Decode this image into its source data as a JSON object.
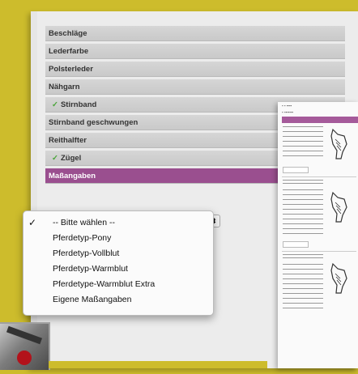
{
  "form": {
    "rows": [
      {
        "label": "Beschläge",
        "tick": false,
        "active": false
      },
      {
        "label": "Lederfarbe",
        "tick": false,
        "active": false
      },
      {
        "label": "Polsterleder",
        "tick": false,
        "active": false
      },
      {
        "label": "Nähgarn",
        "tick": false,
        "active": false
      },
      {
        "label": "Stirnband",
        "tick": true,
        "active": false
      },
      {
        "label": "Stirnband geschwungen",
        "tick": false,
        "active": false
      },
      {
        "label": "Reithalfter",
        "tick": false,
        "active": false
      },
      {
        "label": "Zügel",
        "tick": true,
        "active": false
      },
      {
        "label": "Maßangaben",
        "tick": false,
        "active": true
      }
    ],
    "select_arrow": "⬍"
  },
  "dropdown": {
    "options": [
      "-- Bitte wählen --",
      "Pferdetyp-Pony",
      "Pferdetyp-Vollblut",
      "Pferdetyp-Warmblut",
      "Pferdetype-Warmblut Extra",
      "Eigene Maßangaben"
    ],
    "selected_index": 0
  },
  "accent_color": "#9a4f8f",
  "background_color": "#cdbc2c"
}
